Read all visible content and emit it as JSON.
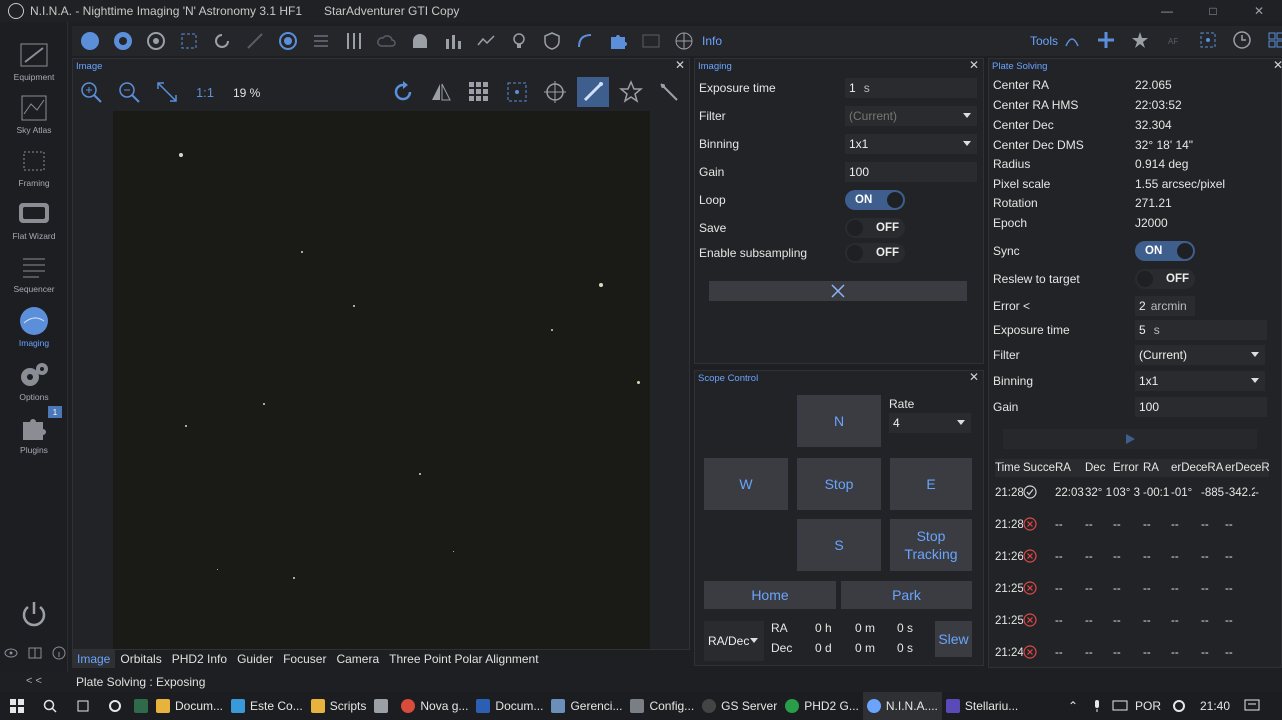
{
  "window": {
    "title": "N.I.N.A. - Nighttime Imaging 'N' Astronomy 3.1 HF1",
    "profile": "StarAdventurer GTI Copy"
  },
  "sidebar": {
    "items": [
      {
        "label": "Equipment"
      },
      {
        "label": "Sky Atlas"
      },
      {
        "label": "Framing"
      },
      {
        "label": "Flat Wizard"
      },
      {
        "label": "Sequencer"
      },
      {
        "label": "Imaging"
      },
      {
        "label": "Options"
      },
      {
        "label": "Plugins"
      }
    ],
    "plugins_badge": "1"
  },
  "toolbar": {
    "info_label": "Info",
    "tools_label": "Tools"
  },
  "image_panel": {
    "title": "Image",
    "zoom_one_label": "1:1",
    "zoom_percent": "19 %"
  },
  "imaging_panel": {
    "title": "Imaging",
    "exposure_time_label": "Exposure time",
    "exposure_time_value": "1",
    "exposure_time_unit": "s",
    "filter_label": "Filter",
    "filter_value": "(Current)",
    "binning_label": "Binning",
    "binning_value": "1x1",
    "gain_label": "Gain",
    "gain_value": "100",
    "loop_label": "Loop",
    "loop_state": "ON",
    "save_label": "Save",
    "save_state": "OFF",
    "subsampling_label": "Enable subsampling",
    "subsampling_state": "OFF"
  },
  "scope_panel": {
    "title": "Scope Control",
    "rate_label": "Rate",
    "rate_value": "4",
    "n_label": "N",
    "w_label": "W",
    "stop_label": "Stop",
    "e_label": "E",
    "s_label": "S",
    "stop_tracking_label": "Stop Tracking",
    "home_label": "Home",
    "park_label": "Park",
    "coord_mode": "RA/Dec",
    "ra_label": "RA",
    "dec_label": "Dec",
    "ra_h": "0 h",
    "ra_m": "0 m",
    "ra_s": "0 s",
    "dec_d": "0 d",
    "dec_m": "0 m",
    "dec_s": "0 s",
    "slew_label": "Slew"
  },
  "plate_panel": {
    "title": "Plate Solving",
    "center_ra_label": "Center RA",
    "center_ra_value": "22.065",
    "center_ra_hms_label": "Center RA HMS",
    "center_ra_hms_value": "22:03:52",
    "center_dec_label": "Center Dec",
    "center_dec_value": "32.304",
    "center_dec_dms_label": "Center Dec DMS",
    "center_dec_dms_value": "32° 18' 14\"",
    "radius_label": "Radius",
    "radius_value": "0.914 deg",
    "pixel_scale_label": "Pixel scale",
    "pixel_scale_value": "1.55 arcsec/pixel",
    "rotation_label": "Rotation",
    "rotation_value": "271.21",
    "epoch_label": "Epoch",
    "epoch_value": "J2000",
    "sync_label": "Sync",
    "sync_state": "ON",
    "reslew_label": "Reslew to target",
    "reslew_state": "OFF",
    "error_label": "Error <",
    "error_value": "2",
    "error_unit": "arcmin",
    "exposure_label": "Exposure time",
    "exposure_value": "5",
    "exposure_unit": "s",
    "filter_label": "Filter",
    "filter_value": "(Current)",
    "binning_label": "Binning",
    "binning_value": "1x1",
    "gain_label": "Gain",
    "gain_value": "100",
    "table_headers": [
      "Time",
      "Succe",
      "RA",
      "Dec",
      "Error",
      "RA",
      "erDec",
      "eRA",
      "erDec",
      "eR"
    ],
    "table_rows": [
      [
        "21:28",
        "ok",
        "22:03",
        "32° 1",
        "03° 3",
        "-00:1",
        "-01°",
        "-885",
        "-342.2",
        "-"
      ],
      [
        "21:28",
        "fail",
        "--",
        "--",
        "--",
        "--",
        "--",
        "--",
        "--",
        ""
      ],
      [
        "21:26",
        "fail",
        "--",
        "--",
        "--",
        "--",
        "--",
        "--",
        "--",
        ""
      ],
      [
        "21:25",
        "fail",
        "--",
        "--",
        "--",
        "--",
        "--",
        "--",
        "--",
        ""
      ],
      [
        "21:25",
        "fail",
        "--",
        "--",
        "--",
        "--",
        "--",
        "--",
        "--",
        ""
      ],
      [
        "21:24",
        "fail",
        "--",
        "--",
        "--",
        "--",
        "--",
        "--",
        "--",
        ""
      ]
    ]
  },
  "bottom_tabs": [
    "Image",
    "Orbitals",
    "PHD2 Info",
    "Guider",
    "Focuser",
    "Camera",
    "Three Point Polar Alignment"
  ],
  "status": {
    "source": "Plate Solving :",
    "message": "Exposing"
  },
  "taskbar": {
    "apps": [
      "Docum...",
      "Este Co...",
      "Scripts",
      "",
      "Nova g...",
      "Docum...",
      "Gerenci...",
      "Config...",
      "GS Server",
      "PHD2 G...",
      "N.I.N.A....",
      "Stellariu..."
    ],
    "language": "POR",
    "time": "21:40"
  },
  "colors": {
    "accent": "#6aa4ff",
    "active_bg": "#3e5e8e",
    "error_red": "#e04848"
  }
}
